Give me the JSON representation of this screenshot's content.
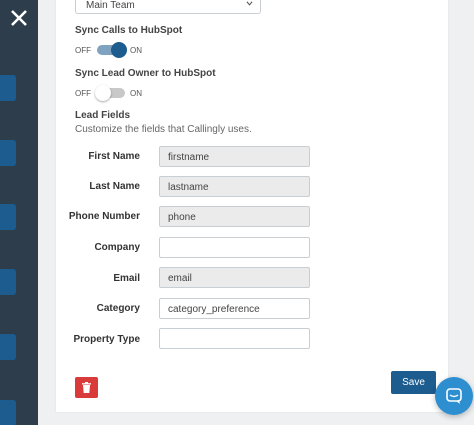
{
  "team_select": {
    "value": "Main Team"
  },
  "sync_calls": {
    "label": "Sync Calls to HubSpot",
    "off_label": "OFF",
    "on_label": "ON",
    "enabled": true
  },
  "sync_owner": {
    "label": "Sync Lead Owner to HubSpot",
    "off_label": "OFF",
    "on_label": "ON",
    "enabled": false
  },
  "lead_fields": {
    "title": "Lead Fields",
    "description": "Customize the fields that Callingly uses.",
    "fields": [
      {
        "label": "First Name",
        "value": "firstname",
        "readonly": true
      },
      {
        "label": "Last Name",
        "value": "lastname",
        "readonly": true
      },
      {
        "label": "Phone Number",
        "value": "phone",
        "readonly": true
      },
      {
        "label": "Company",
        "value": "",
        "readonly": false
      },
      {
        "label": "Email",
        "value": "email",
        "readonly": true
      },
      {
        "label": "Category",
        "value": "category_preference",
        "readonly": false
      },
      {
        "label": "Property Type",
        "value": "",
        "readonly": false
      }
    ]
  },
  "actions": {
    "save_label": "Save"
  },
  "icons": {
    "close": "close-icon",
    "delete": "trash-icon",
    "chat": "chat-icon",
    "caret": "chevron-down-icon"
  },
  "colors": {
    "primary": "#1d5c8e",
    "danger": "#d93a3a",
    "chat": "#2d8fd0",
    "backdrop": "#2e3d4c"
  }
}
